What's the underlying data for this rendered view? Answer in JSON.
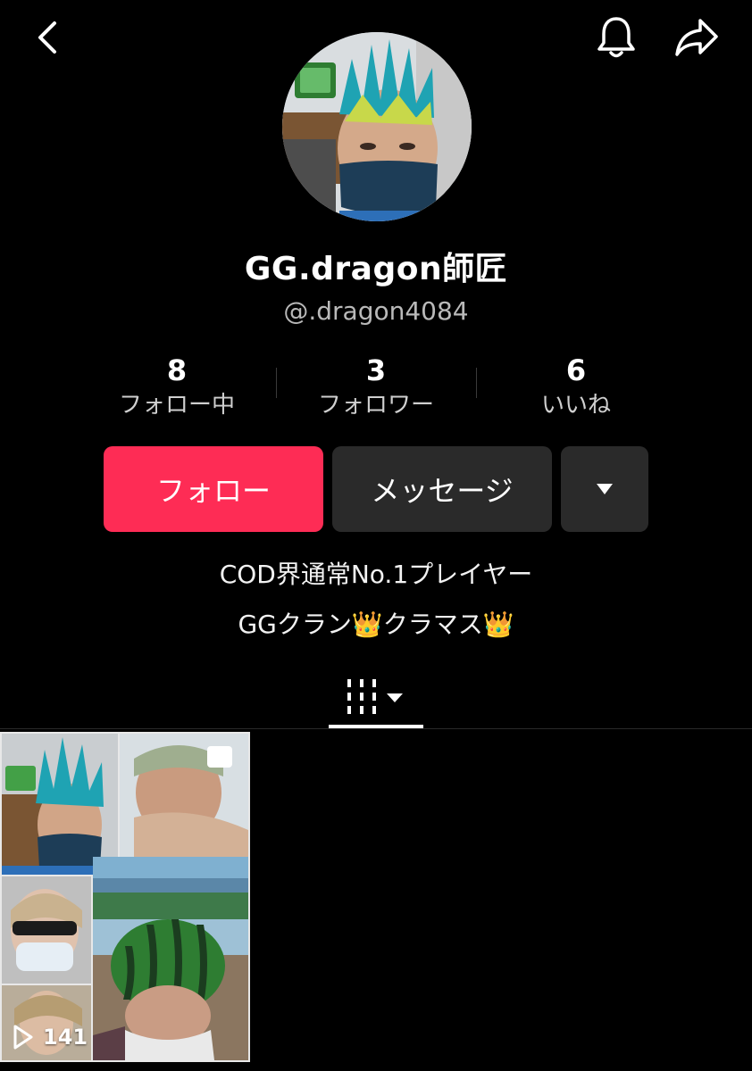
{
  "profile": {
    "display_name": "GG.dragon師匠",
    "username": "@.dragon4084",
    "bio": [
      "COD界通常No.1プレイヤー",
      "GGクラン👑クラマス👑"
    ]
  },
  "stats": [
    {
      "value": "8",
      "label": "フォロー中"
    },
    {
      "value": "3",
      "label": "フォロワー"
    },
    {
      "value": "6",
      "label": "いいね"
    }
  ],
  "actions": {
    "follow_label": "フォロー",
    "message_label": "メッセージ"
  },
  "icons": {
    "back": "chevron-left-icon",
    "notifications": "bell-icon",
    "share": "share-arrow-icon",
    "more": "caret-down-icon",
    "videos_tab": "grid-icon",
    "play": "play-icon"
  },
  "videos": [
    {
      "play_count": "141"
    }
  ],
  "colors": {
    "background": "#000000",
    "follow_button": "#fe2c55",
    "secondary_button": "#2a2a2a"
  }
}
